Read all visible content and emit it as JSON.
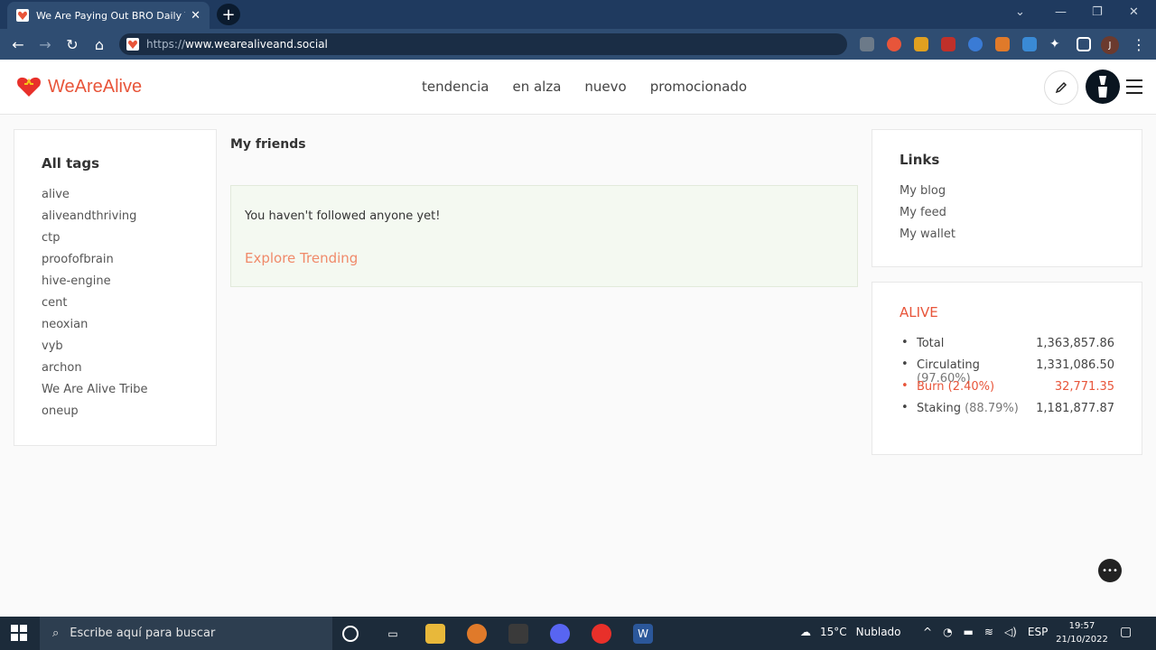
{
  "browser": {
    "tab_title": "We Are Paying Out BRO Daily To",
    "tab_close": "✕",
    "new_tab": "+",
    "url_protocol": "https://",
    "url_host": "www.wearealiveand.social",
    "profile_initial": "J"
  },
  "site": {
    "logo_text": "WeAreAlive",
    "brand_color": "#e8553a",
    "nav": [
      "tendencia",
      "en alza",
      "nuevo",
      "promocionado"
    ]
  },
  "tags": {
    "title": "All tags",
    "items": [
      "alive",
      "aliveandthriving",
      "ctp",
      "proofofbrain",
      "hive-engine",
      "cent",
      "neoxian",
      "vyb",
      "archon",
      "We Are Alive Tribe",
      "oneup"
    ]
  },
  "friends": {
    "title": "My friends",
    "empty_message": "You haven't followed anyone yet!",
    "explore_link": "Explore Trending"
  },
  "links": {
    "title": "Links",
    "items": [
      "My blog",
      "My feed",
      "My wallet"
    ]
  },
  "alive": {
    "title": "ALIVE",
    "stats": [
      {
        "label": "Total",
        "pct": "",
        "value": "1,363,857.86"
      },
      {
        "label": "Circulating",
        "pct": "(97.60%)",
        "value": "1,331,086.50"
      },
      {
        "label": "Burn",
        "pct": "(2.40%)",
        "value": "32,771.35"
      },
      {
        "label": "Staking",
        "pct": "(88.79%)",
        "value": "1,181,877.87"
      }
    ]
  },
  "taskbar": {
    "search_placeholder": "Escribe aquí para buscar",
    "temperature": "15°C",
    "weather": "Nublado",
    "language": "ESP",
    "time": "19:57",
    "date": "21/10/2022"
  }
}
